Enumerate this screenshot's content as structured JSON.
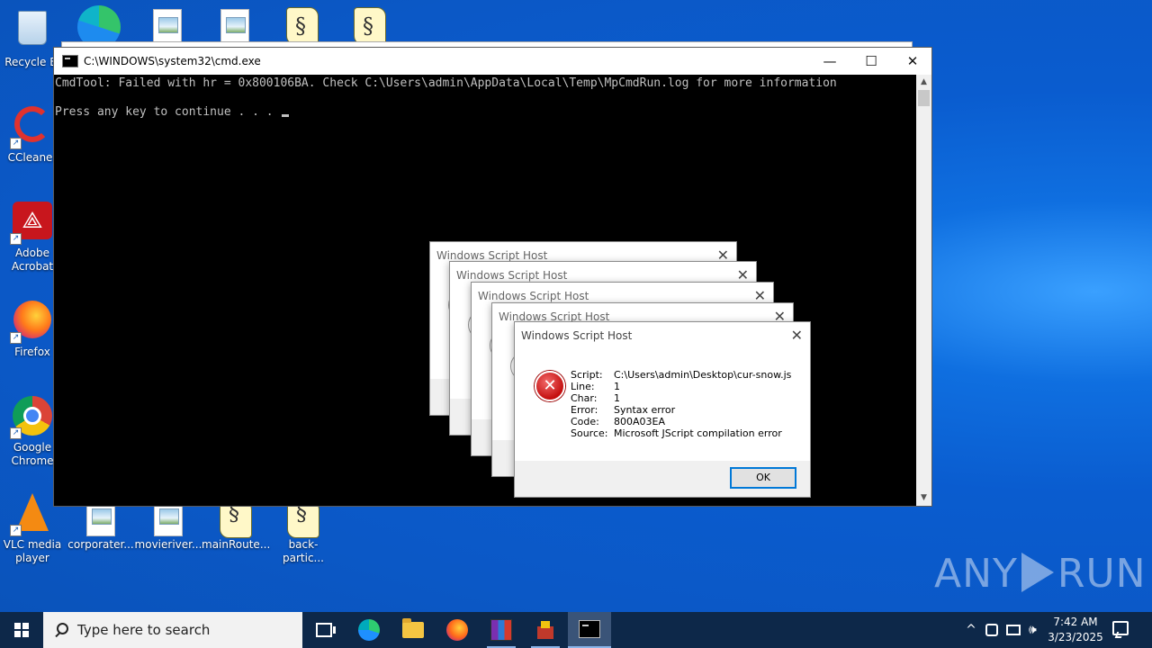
{
  "desktop": {
    "icons": [
      {
        "label": "Recycle Bin",
        "display": "Recycle Bi",
        "icon": "recycle-bin-icon"
      },
      {
        "label": "CCleaner",
        "display": "CCleaner",
        "icon": "ccleaner-icon"
      },
      {
        "label": "Adobe Acrobat",
        "display": "Adobe Acrobat",
        "icon": "acrobat-icon"
      },
      {
        "label": "Firefox",
        "display": "Firefox",
        "icon": "firefox-icon"
      },
      {
        "label": "Google Chrome",
        "display": "Google Chrome",
        "icon": "chrome-icon"
      },
      {
        "label": "VLC media player",
        "display": "VLC media player",
        "icon": "vlc-icon"
      },
      {
        "label": "corporater...",
        "display": "corporater...",
        "icon": "image-file-icon"
      },
      {
        "label": "movieriver...",
        "display": "movieriver...",
        "icon": "image-file-icon"
      },
      {
        "label": "mainRoute...",
        "display": "mainRoute...",
        "icon": "script-file-icon"
      },
      {
        "label": "back-partic...",
        "display": "back-partic...",
        "icon": "script-file-icon"
      }
    ]
  },
  "cmd": {
    "title": "C:\\WINDOWS\\system32\\cmd.exe",
    "line1": "CmdTool: Failed with hr = 0x800106BA. Check C:\\Users\\admin\\AppData\\Local\\Temp\\MpCmdRun.log for more information",
    "line2": "Press any key to continue . . . ",
    "buttons": {
      "minimize": "—",
      "maximize": "☐",
      "close": "✕"
    }
  },
  "wsh": {
    "title": "Windows Script Host",
    "close_glyph": "✕",
    "fields": [
      {
        "key": "Script:",
        "value": "C:\\Users\\admin\\Desktop\\cur-snow.js"
      },
      {
        "key": "Line:",
        "value": "1"
      },
      {
        "key": "Char:",
        "value": "1"
      },
      {
        "key": "Error:",
        "value": "Syntax error"
      },
      {
        "key": "Code:",
        "value": "800A03EA"
      },
      {
        "key": "Source:",
        "value": "Microsoft JScript compilation error"
      }
    ],
    "ok_label": "OK",
    "error_glyph": "✕"
  },
  "watermark": {
    "left": "ANY",
    "right": "RUN"
  },
  "taskbar": {
    "search_placeholder": "Type here to search",
    "pinned": [
      "task-view",
      "edge",
      "file-explorer",
      "firefox",
      "winrar",
      "app",
      "cmd"
    ],
    "tray": {
      "chevron": "^",
      "time": "7:42 AM",
      "date": "3/23/2025"
    }
  }
}
